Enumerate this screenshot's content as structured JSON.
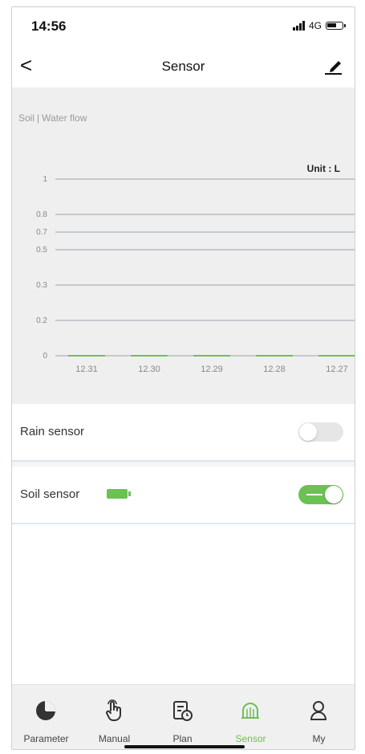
{
  "status": {
    "time": "14:56",
    "network": "4G"
  },
  "nav": {
    "back_label": "<",
    "title": "Sensor"
  },
  "chart_tabs": {
    "left": "Soil",
    "right": "Water flow"
  },
  "chart_data": {
    "type": "bar",
    "categories": [
      "12.31",
      "12.30",
      "12.29",
      "12.28",
      "12.27"
    ],
    "values": [
      0,
      0,
      0,
      0,
      0
    ],
    "y_ticks": [
      "1",
      "0.8",
      "0.7",
      "0.5",
      "0.3",
      "0.2",
      "0"
    ],
    "unit_label": "Unit : L",
    "grid": true,
    "bar_color": "#6cc153"
  },
  "rain_sensor": {
    "label": "Rain sensor",
    "on": false
  },
  "soil_sensor": {
    "label": "Soil sensor",
    "on": true,
    "battery_icon": "battery-icon"
  },
  "tabbar": {
    "items": [
      {
        "label": "Parameter",
        "icon": "pie-chart-icon"
      },
      {
        "label": "Manual",
        "icon": "hand-pointer-icon"
      },
      {
        "label": "Plan",
        "icon": "plan-document-icon"
      },
      {
        "label": "Sensor",
        "icon": "sensor-icon"
      },
      {
        "label": "My",
        "icon": "user-icon"
      }
    ],
    "active": "Sensor"
  },
  "colors": {
    "accent": "#6cc153",
    "panel": "#efefef"
  }
}
